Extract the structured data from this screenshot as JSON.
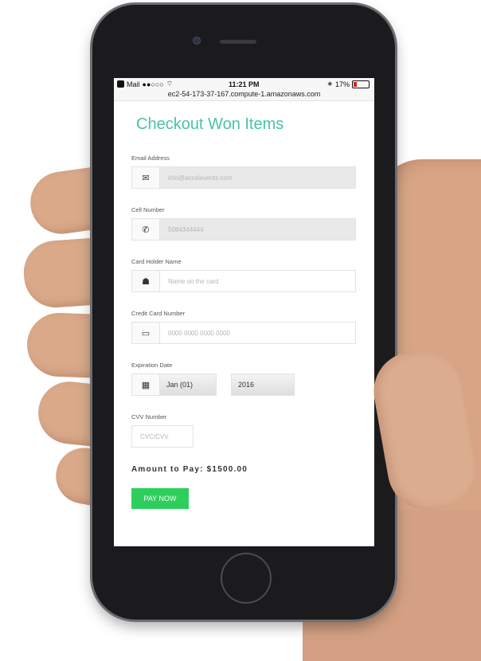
{
  "status_bar": {
    "carrier": "Mail",
    "signal": "●●○○○",
    "time": "11:21 PM",
    "battery_percent": "17%",
    "url": "ec2-54-173-37-167.compute-1.amazonaws.com"
  },
  "page": {
    "title": "Checkout Won Items"
  },
  "form": {
    "email": {
      "label": "Email Address",
      "value": "info@accelevents.com"
    },
    "phone": {
      "label": "Cell Number",
      "value": "5084344444"
    },
    "card_holder": {
      "label": "Card Holder Name",
      "placeholder": "Name on the card"
    },
    "card_number": {
      "label": "Credit Card Number",
      "placeholder": "0000 0000 0000 0000"
    },
    "expiration": {
      "label": "Expiration Date",
      "month": "Jan (01)",
      "year": "2016"
    },
    "cvv": {
      "label": "CVV Number",
      "placeholder": "CVC/CVV"
    }
  },
  "amount_text": "Amount to Pay: $1500.00",
  "pay_button_label": "PAY NOW",
  "colors": {
    "title": "#49c2a8",
    "pay_button": "#2dcf5c"
  },
  "icons": [
    "envelope-icon",
    "phone-icon",
    "user-icon",
    "credit-card-icon",
    "calendar-icon"
  ]
}
